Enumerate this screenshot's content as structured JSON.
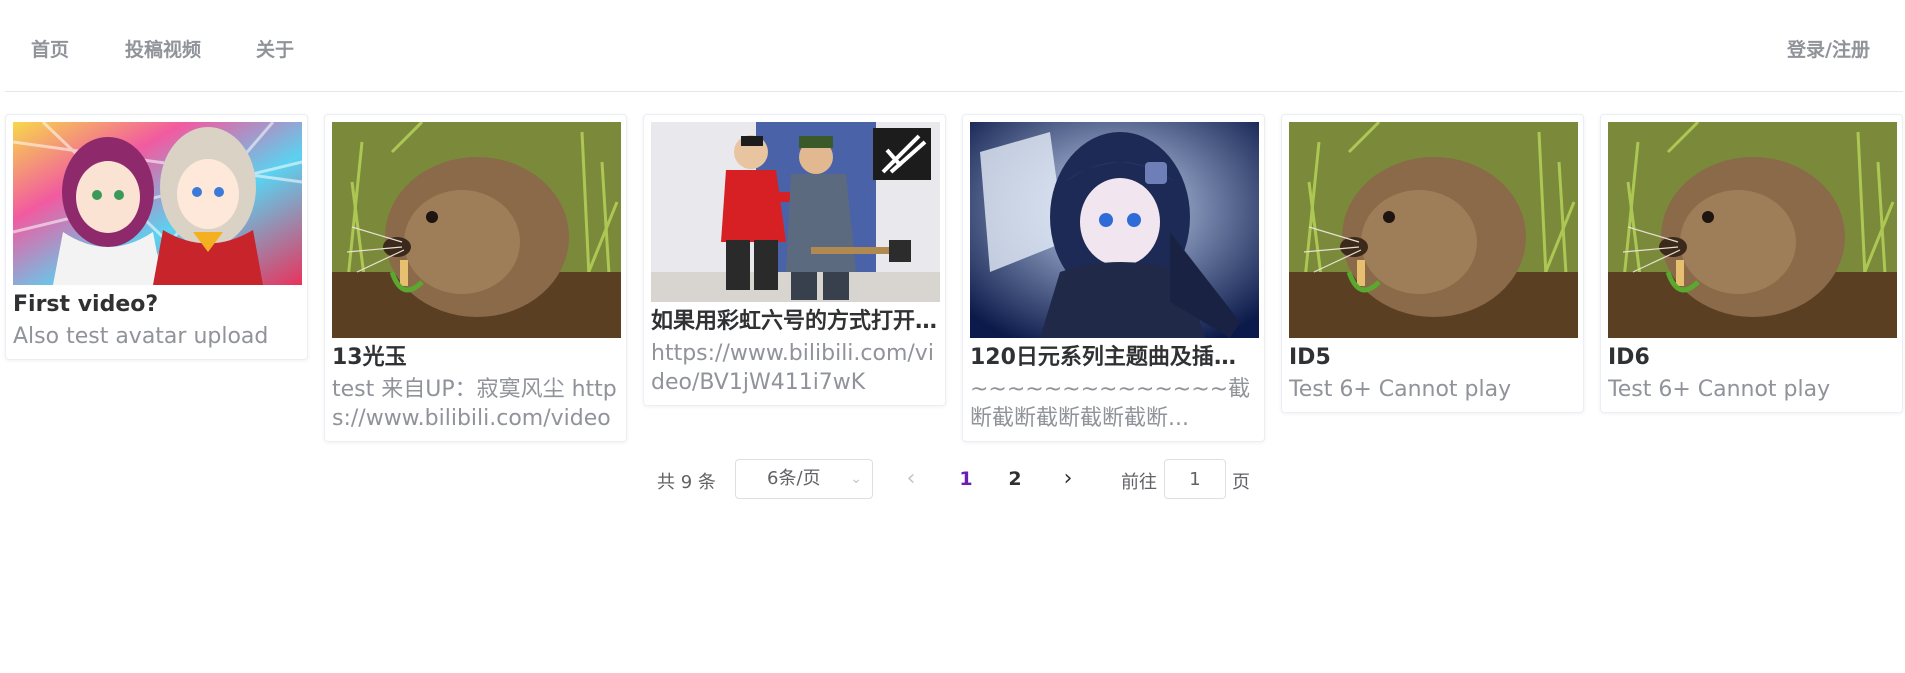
{
  "nav": {
    "home": "首页",
    "upload": "投稿视频",
    "about": "关于",
    "login": "登录/注册"
  },
  "cards": [
    {
      "title": "First video?",
      "desc": "Also test avatar upload",
      "thumb_icon": "anime-girls-thumbnail"
    },
    {
      "title": "13光玉",
      "desc": "test 来自UP：寂寞风尘 https://www.bilibili.com/video",
      "thumb_icon": "gopher-thumbnail"
    },
    {
      "title": "如果用彩虹六号的方式打开...",
      "desc": "https://www.bilibili.com/video/BV1jW411i7wK",
      "thumb_icon": "sketch-comedy-thumbnail"
    },
    {
      "title": "120日元系列主题曲及插入...",
      "desc": "~~~~~~~~~~~~~~截断截断截断截断截断...",
      "thumb_icon": "anime-girl-thumbnail"
    },
    {
      "title": "ID5",
      "desc": "Test 6+ Cannot play",
      "thumb_icon": "gopher-thumbnail"
    },
    {
      "title": "ID6",
      "desc": "Test 6+ Cannot play",
      "thumb_icon": "gopher-thumbnail"
    }
  ],
  "pagination": {
    "total": "共 9 条",
    "page_size": "6条/页",
    "pages": [
      "1",
      "2"
    ],
    "current_page": "1",
    "goto_label": "前往",
    "goto_value": "1",
    "page_suffix": "页"
  },
  "colors": {
    "accent": "#6a1fb0",
    "muted": "#909399"
  }
}
